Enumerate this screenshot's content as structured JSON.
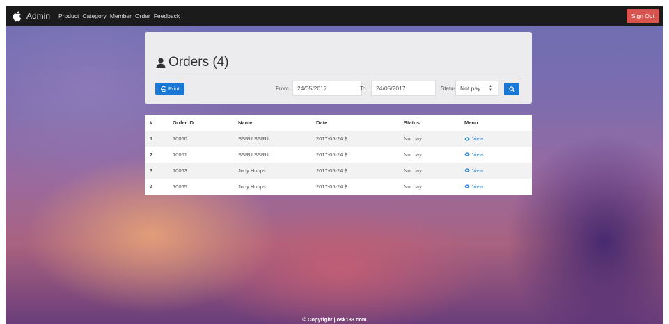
{
  "navbar": {
    "brand": "Admin",
    "links": [
      "Product",
      "Category",
      "Member",
      "Order",
      "Feedback"
    ],
    "signout": "Sign Out"
  },
  "panel": {
    "title": "Orders (4)",
    "print_label": "Print",
    "from_label": "From...",
    "from_value": "24/05/2017",
    "to_label": "To...",
    "to_value": "24/05/2017",
    "status_label": "Status",
    "status_value": "Not pay"
  },
  "table": {
    "headers": [
      "#",
      "Order ID",
      "Name",
      "Date",
      "Status",
      "Menu"
    ],
    "rows": [
      {
        "n": "1",
        "order_id": "10060",
        "name": "SSRU SSRU",
        "date": "2017-05-24 ฿",
        "status": "Not pay",
        "menu": "View"
      },
      {
        "n": "2",
        "order_id": "10061",
        "name": "SSRU SSRU",
        "date": "2017-05-24 ฿",
        "status": "Not pay",
        "menu": "View"
      },
      {
        "n": "3",
        "order_id": "10063",
        "name": "Judy Hopps",
        "date": "2017-05-24 ฿",
        "status": "Not pay",
        "menu": "View"
      },
      {
        "n": "4",
        "order_id": "10065",
        "name": "Judy Hopps",
        "date": "2017-05-24 ฿",
        "status": "Not pay",
        "menu": "View"
      }
    ]
  },
  "footer": "© Copyright | osk133.com",
  "colors": {
    "navbar": "#1b1b1b",
    "signout": "#d9534f",
    "primary": "#1977d6",
    "status_notpay": "#e06565",
    "link": "#3a8bd6"
  },
  "icons": {
    "brand": "apple-icon",
    "title": "user-icon",
    "print": "print-icon",
    "search": "search-icon",
    "view": "eye-icon"
  }
}
